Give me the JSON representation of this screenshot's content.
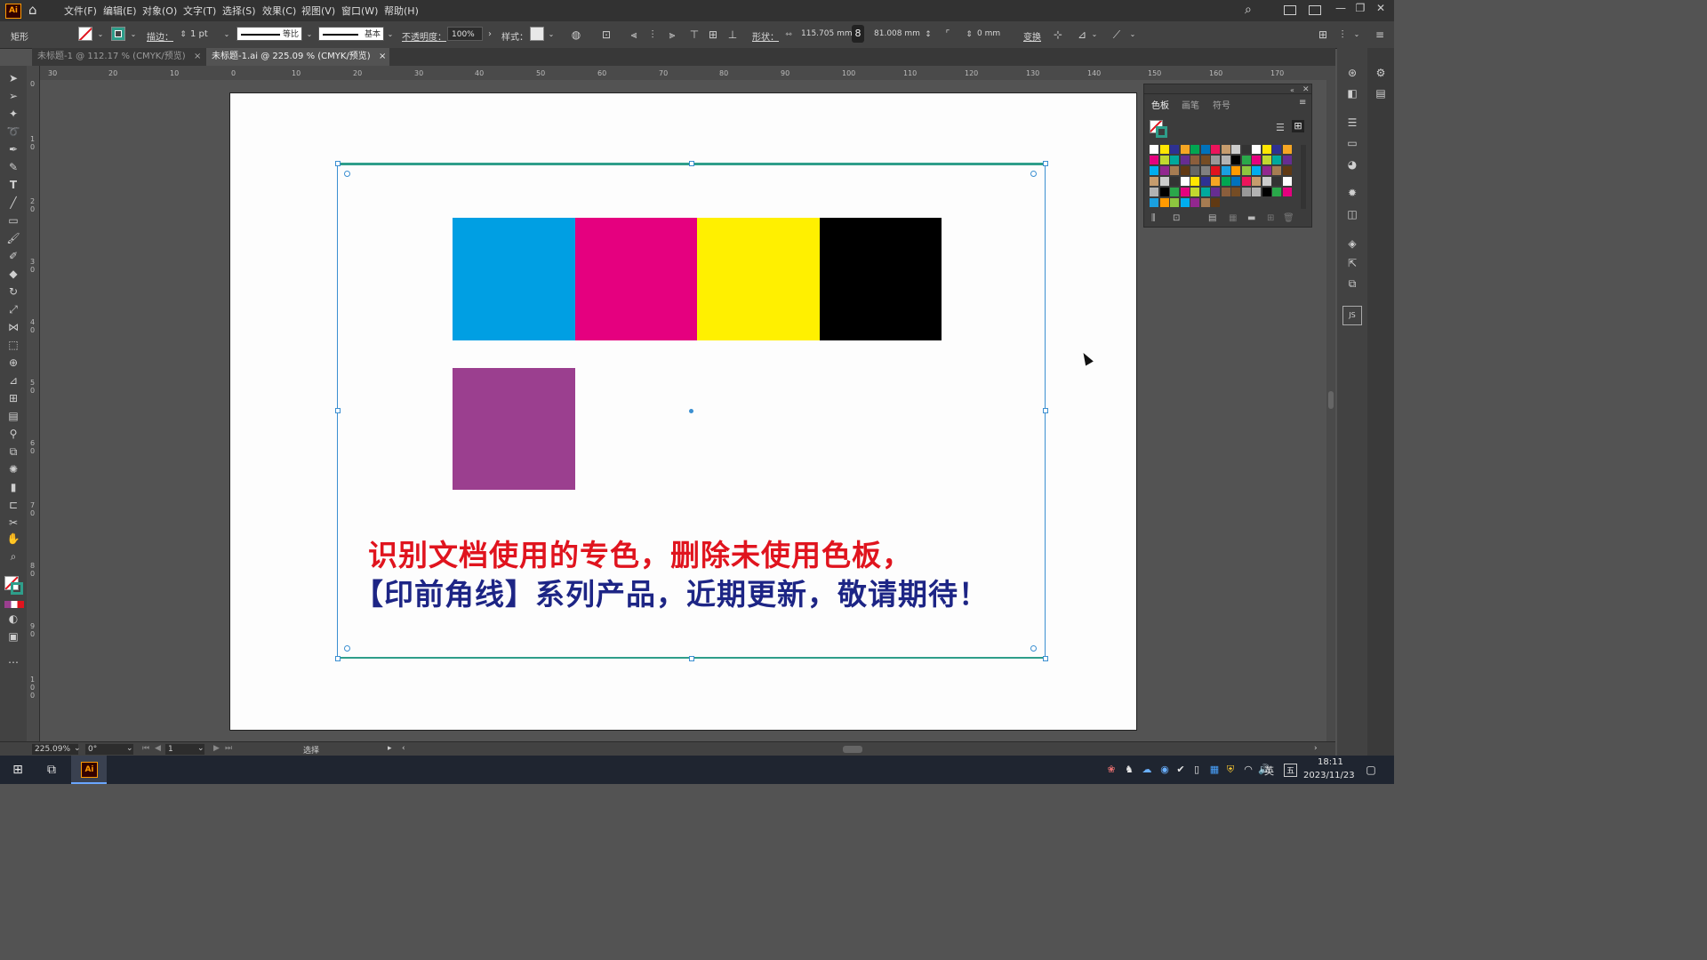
{
  "menubar": {
    "app_badge": "Ai",
    "items": [
      "文件(F)",
      "编辑(E)",
      "对象(O)",
      "文字(T)",
      "选择(S)",
      "效果(C)",
      "视图(V)",
      "窗口(W)",
      "帮助(H)"
    ]
  },
  "control_bar": {
    "object_type": "矩形",
    "stroke_label": "描边：",
    "stroke_weight": "1 pt",
    "profile_uniform": "等比",
    "brush_basic": "基本",
    "opacity_label": "不透明度：",
    "opacity_value": "100%",
    "style_label": "样式：",
    "shape_label": "形状：",
    "width_value": "115.705 mm",
    "height_value": "81.008 mm",
    "corner_value": "0 mm",
    "transform_label": "变换"
  },
  "tabs": [
    {
      "label": "未标题-1 @ 112.17 % (CMYK/预览)",
      "close": "×"
    },
    {
      "label": "未标题-1.ai @ 225.09 % (CMYK/预览)",
      "close": "×"
    }
  ],
  "ruler": {
    "h_ticks": [
      "30",
      "20",
      "10",
      "0",
      "10",
      "20",
      "30",
      "40",
      "50",
      "60",
      "70",
      "80",
      "90",
      "100",
      "110",
      "120",
      "130",
      "140",
      "150",
      "160",
      "170"
    ],
    "v_ticks": [
      "0",
      "1 0",
      "2 0",
      "3 0",
      "4 0",
      "5 0",
      "6 0",
      "7 0",
      "8 0",
      "9 0",
      "1 0 0"
    ]
  },
  "artwork": {
    "cmyk_swatches": [
      {
        "name": "cyan",
        "color": "#009fe3"
      },
      {
        "name": "magenta",
        "color": "#e5007f"
      },
      {
        "name": "yellow",
        "color": "#fff000"
      },
      {
        "name": "black",
        "color": "#000000"
      }
    ],
    "spot_swatch": {
      "name": "purple",
      "color": "#9b3f8f"
    },
    "line1": "识别文档使用的专色，删除未使用色板，",
    "line1_color": "#e0141e",
    "line2": "【印前角线】系列产品，近期更新，敬请期待！",
    "line2_color": "#1d2585"
  },
  "swatches_panel": {
    "tabs": [
      "色板",
      "画笔",
      "符号"
    ]
  },
  "statusbar": {
    "zoom": "225.09%",
    "rotation": "0°",
    "artboard_num": "1",
    "mode": "选择"
  },
  "taskbar": {
    "app_badge": "Ai",
    "ime": "英",
    "ime2": "五",
    "time": "18:11",
    "date": "2023/11/23"
  },
  "colors": {
    "accent_selection": "#3b8fd1",
    "ai_orange": "#ff9a00"
  }
}
